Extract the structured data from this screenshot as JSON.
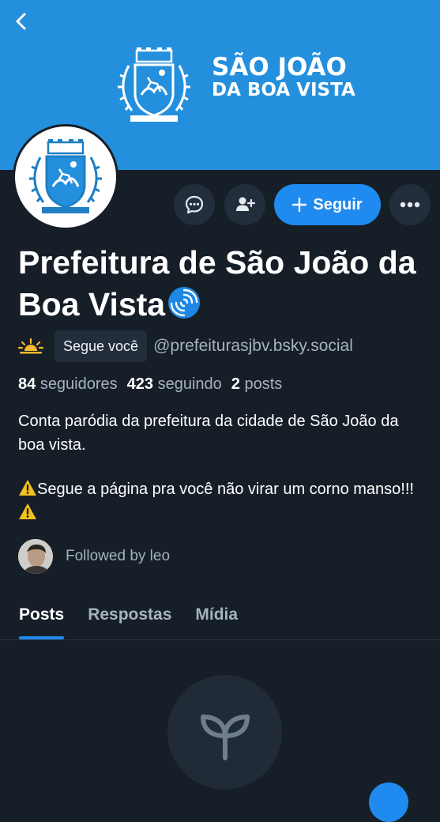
{
  "banner": {
    "title_line1": "SÃO JOÃO",
    "title_line2": "DA BOA VISTA",
    "color": "#2490dd"
  },
  "profile": {
    "display_name": "Prefeitura de São João da Boa Vista",
    "name_emoji": "cyclone-icon",
    "follows_you": "Segue você",
    "handle": "@prefeiturasjbv.bsky.social",
    "followers_count": "84",
    "followers_label": "seguidores",
    "following_count": "423",
    "following_label": "seguindo",
    "posts_count": "2",
    "posts_label": "posts",
    "bio_line1": "Conta paródia da prefeitura da cidade de São João da boa vista.",
    "bio_line2": "Segue a página pra você não virar um corno manso!!!",
    "followed_by": "Followed by leo"
  },
  "actions": {
    "follow_label": "Seguir",
    "accent": "#1f8bf0"
  },
  "tabs": [
    {
      "label": "Posts",
      "active": true
    },
    {
      "label": "Respostas",
      "active": false
    },
    {
      "label": "Mídia",
      "active": false
    }
  ]
}
